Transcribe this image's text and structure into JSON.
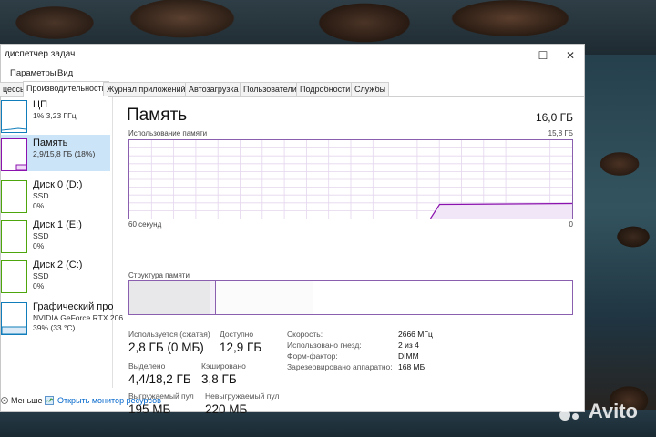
{
  "window": {
    "title": "диспетчер задач",
    "controls": {
      "minimize": "—",
      "maximize": "☐",
      "close": "✕"
    }
  },
  "menu": [
    "Параметры",
    "Вид"
  ],
  "tabs": [
    "цессы",
    "Производительность",
    "Журнал приложений",
    "Автозагрузка",
    "Пользователи",
    "Подробности",
    "Службы"
  ],
  "active_tab": "Производительность",
  "sidebar": {
    "items": [
      {
        "name": "ЦП",
        "sub1": "1% 3,23 ГГц",
        "sub2": "",
        "color": "#117dbb"
      },
      {
        "name": "Память",
        "sub1": "2,9/15,8 ГБ (18%)",
        "sub2": "",
        "color": "#8b12ae",
        "active": true
      },
      {
        "name": "Диск 0 (D:)",
        "sub1": "SSD",
        "sub2": "0%",
        "color": "#4da60c"
      },
      {
        "name": "Диск 1 (E:)",
        "sub1": "SSD",
        "sub2": "0%",
        "color": "#4da60c"
      },
      {
        "name": "Диск 2 (C:)",
        "sub1": "SSD",
        "sub2": "0%",
        "color": "#4da60c"
      },
      {
        "name": "Графический про",
        "sub1": "NVIDIA GeForce RTX 206",
        "sub2": "39% (33 °C)",
        "color": "#117dbb"
      }
    ]
  },
  "main": {
    "title": "Память",
    "total": "16,0 ГБ",
    "usage_label": "Использование памяти",
    "usage_max": "15,8 ГБ",
    "time_label": "60 секунд",
    "zero_label": "0",
    "structure_label": "Структура памяти",
    "usage_fraction": 0.18
  },
  "stats": {
    "in_use_label": "Используется (сжатая)",
    "in_use_value": "2,8 ГБ (0 МБ)",
    "available_label": "Доступно",
    "available_value": "12,9 ГБ",
    "committed_label": "Выделено",
    "committed_value": "4,4/18,2 ГБ",
    "cached_label": "Кэшировано",
    "cached_value": "3,8 ГБ",
    "paged_label": "Выгружаемый пул",
    "paged_value": "195 МБ",
    "nonpaged_label": "Невыгружаемый пул",
    "nonpaged_value": "220 МБ"
  },
  "details": [
    {
      "key": "Скорость:",
      "value": "2666 МГц"
    },
    {
      "key": "Использовано гнезд:",
      "value": "2 из 4"
    },
    {
      "key": "Форм-фактор:",
      "value": "DIMM"
    },
    {
      "key": "Зарезервировано аппаратно:",
      "value": "168 МБ"
    }
  ],
  "footer": {
    "less_label": "Меньше",
    "monitor_label": "Открыть монитор ресурсов"
  },
  "watermark": "Avito",
  "colors": {
    "memory": "#8b12ae",
    "selection": "#cce4f7",
    "link": "#0066cc"
  }
}
